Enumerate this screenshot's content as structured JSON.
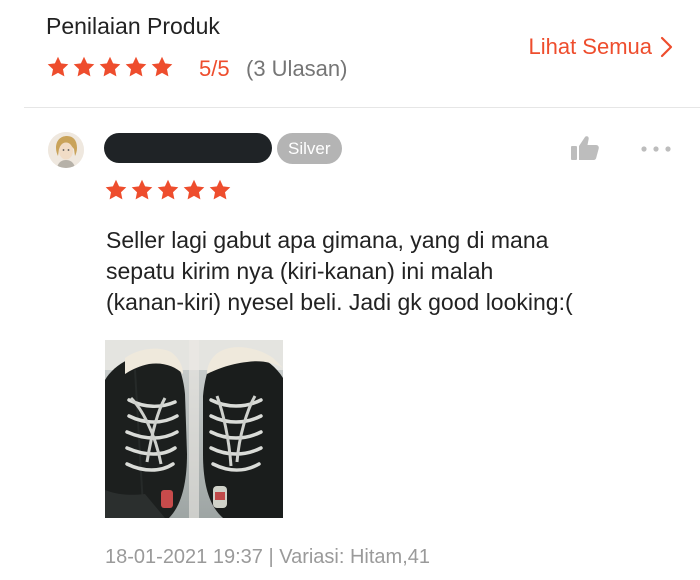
{
  "header": {
    "title": "Penilaian Produk",
    "rating_score": "5/5",
    "rating_count": "(3 Ulasan)",
    "see_all_label": "Lihat Semua",
    "stars": 5
  },
  "review": {
    "badge": "Silver",
    "stars": 5,
    "text_lines": [
      "Seller lagi gabut apa gimana, yang di mana",
      "sepatu kirim nya (kiri-kanan)  ini malah",
      "(kanan-kiri)  nyesel beli. Jadi gk good looking:("
    ],
    "meta": "18-01-2021 19:37 | Variasi: Hitam,41"
  },
  "colors": {
    "accent": "#ee4d2d",
    "star": "#ee4d2d",
    "badge_bg": "#b4b4b4",
    "muted_text": "#9a9a9a"
  },
  "icons": {
    "star": "star-icon",
    "chevron": "chevron-right-icon",
    "like": "thumbs-up-icon",
    "more": "more-horizontal-icon"
  }
}
